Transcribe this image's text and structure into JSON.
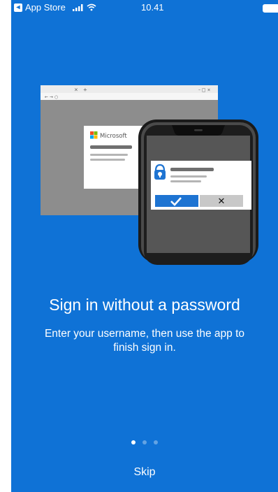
{
  "status_bar": {
    "back_app": "App Store",
    "time": "10.41"
  },
  "illustration": {
    "browser_close": "×",
    "browser_newtab": "+",
    "browser_window_controls": "– □ ×",
    "browser_nav": "← → ○",
    "brand_name": "Microsoft",
    "reject_symbol": "✕"
  },
  "onboarding": {
    "title": "Sign in without a password",
    "subtitle": "Enter your username, then use the app to finish sign in.",
    "page_count": 3,
    "current_page": 1,
    "skip_label": "Skip"
  },
  "colors": {
    "background": "#0f72d6",
    "approve": "#1e74d2"
  }
}
